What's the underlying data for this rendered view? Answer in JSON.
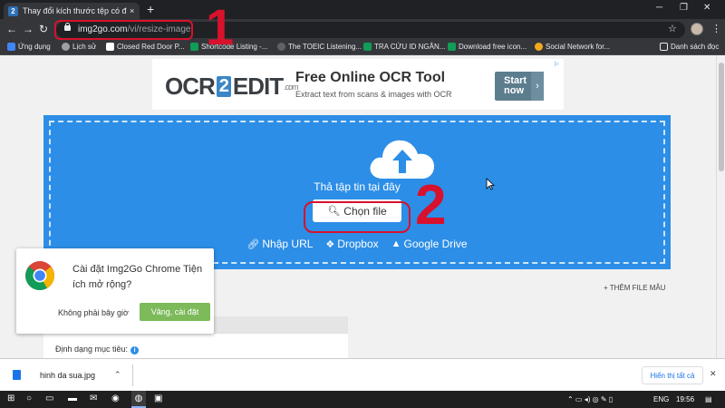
{
  "browser": {
    "tab_title": "Thay đổi kích thước tệp có định dạng",
    "tab_close": "×",
    "new_tab": "+",
    "url_host": "img2go.com",
    "url_path": "/vi/resize-image",
    "bookmarks": [
      {
        "label": "Ứng dụng",
        "color": "#4285f4"
      },
      {
        "label": "Lịch sử",
        "color": "#9aa0a6"
      },
      {
        "label": "Closed Red Door P...",
        "color": "#ffffff"
      },
      {
        "label": "Shortcode Listing -...",
        "color": "#0f9d58"
      },
      {
        "label": "The TOEIC Listening...",
        "color": "#9aa0a6"
      },
      {
        "label": "TRA CỨU ID NGÂN...",
        "color": "#0f9d58"
      },
      {
        "label": "Download free icon...",
        "color": "#0f9d58"
      },
      {
        "label": "Social Network for...",
        "color": "#f4a81d"
      },
      {
        "label": "Danh sách đọc",
        "color": "#e8eaed"
      }
    ]
  },
  "ad": {
    "logo_left": "OCR",
    "logo_mid": "2",
    "logo_right": "EDIT",
    "logo_suffix": ".com",
    "headline": "Free Online OCR Tool",
    "description": "Extract text from scans & images with OCR",
    "cta_line1": "Start",
    "cta_line2": "now"
  },
  "upload": {
    "drop_text": "Thả tập tin tại đây",
    "choose_file": "Chọn file",
    "links": [
      {
        "label": "Nhập URL",
        "icon": "link-icon"
      },
      {
        "label": "Dropbox",
        "icon": "dropbox-icon"
      },
      {
        "label": "Google Drive",
        "icon": "google-drive-icon"
      }
    ]
  },
  "page": {
    "add_sample": "THÊM FILE MẪU",
    "format_label": "Định dạng mục tiêu:"
  },
  "popup": {
    "text": "Cài đặt Img2Go Chrome Tiện ích mở rộng?",
    "dismiss": "Không phải bây giờ",
    "accept": "Vâng, cài đặt"
  },
  "annotations": {
    "one": "1",
    "two": "2",
    "color": "#d8112c"
  },
  "download_bar": {
    "file_name": "hinh da sua.jpg",
    "show_all": "Hiển thị tất cả"
  },
  "taskbar": {
    "language": "ENG",
    "time": "19:56"
  },
  "colors": {
    "upload_blue": "#2c8ee6",
    "accept_green": "#7cba5a",
    "chrome_dark": "#35363a"
  }
}
